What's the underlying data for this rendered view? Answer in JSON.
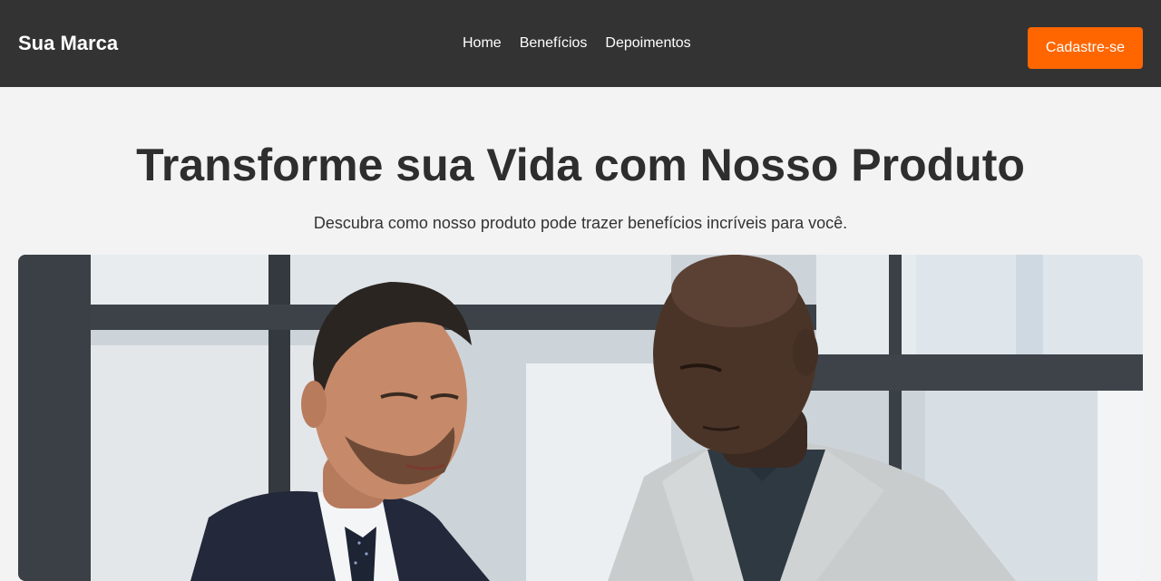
{
  "header": {
    "brand": "Sua Marca",
    "nav": [
      {
        "label": "Home"
      },
      {
        "label": "Benefícios"
      },
      {
        "label": "Depoimentos"
      }
    ],
    "cta_label": "Cadastre-se"
  },
  "hero": {
    "title": "Transforme sua Vida com Nosso Produto",
    "subtitle": "Descubra como nosso produto pode trazer benefícios incríveis para você.",
    "image_alt": "Dois homens de negócios olhando para um documento em um escritório"
  },
  "colors": {
    "header_bg": "#333333",
    "accent": "#ff6600",
    "page_bg": "#f3f3f3",
    "title": "#2e2e2e"
  }
}
